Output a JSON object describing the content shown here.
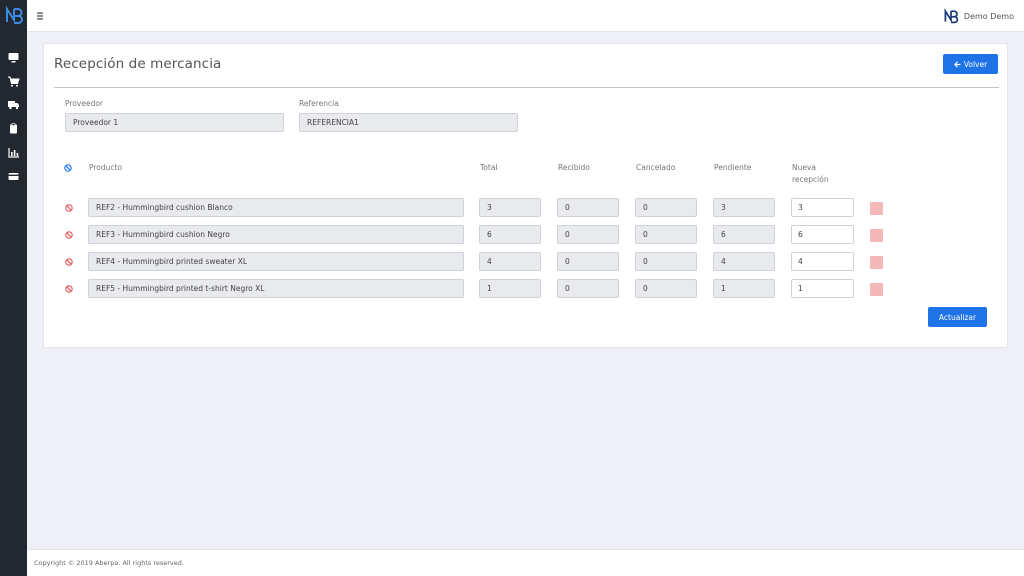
{
  "header": {
    "user_name": "Demo Demo"
  },
  "page": {
    "title": "Recepción de mercancia",
    "back_label": "Volver",
    "update_label": "Actualizar"
  },
  "form": {
    "supplier_label": "Proveedor",
    "supplier_value": "Proveedor 1",
    "reference_label": "Referencia",
    "reference_value": "REFERENCIA1"
  },
  "table": {
    "columns": {
      "product": "Producto",
      "total": "Total",
      "received": "Recibido",
      "cancelled": "Cancelado",
      "pending": "Pendiente",
      "new_reception": "Nueva recepción"
    },
    "rows": [
      {
        "product": "REF2 - Hummingbird cushion Blanco",
        "total": "3",
        "received": "0",
        "cancelled": "0",
        "pending": "3",
        "new_reception": "3"
      },
      {
        "product": "REF3 - Hummingbird cushion Negro",
        "total": "6",
        "received": "0",
        "cancelled": "0",
        "pending": "6",
        "new_reception": "6"
      },
      {
        "product": "REF4 - Hummingbird printed sweater XL",
        "total": "4",
        "received": "0",
        "cancelled": "0",
        "pending": "4",
        "new_reception": "4"
      },
      {
        "product": "REF5 - Hummingbird printed t-shirt Negro XL",
        "total": "1",
        "received": "0",
        "cancelled": "0",
        "pending": "1",
        "new_reception": "1"
      }
    ]
  },
  "footer": {
    "copyright": "Copyright © 2019 Aberpa. All rights reserved."
  },
  "colors": {
    "primary": "#1e74e6",
    "sidebar": "#23272f",
    "danger": "#e05555",
    "danger_light": "#f4b8b8"
  },
  "icons": [
    "brand-logo-icon",
    "monitor-icon",
    "cart-icon",
    "truck-icon",
    "clipboard-icon",
    "chart-icon",
    "card-icon",
    "hamburger-icon",
    "arrow-left-icon",
    "ban-icon"
  ]
}
